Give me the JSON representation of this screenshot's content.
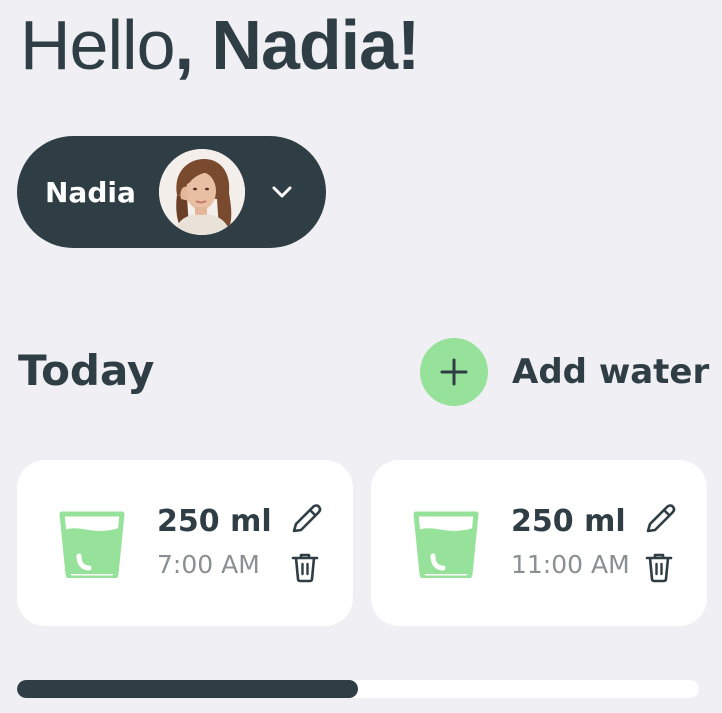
{
  "greeting": {
    "hello": "Hello",
    "name": ", Nadia!"
  },
  "user_selector": {
    "name": "Nadia",
    "avatar_icon": "user-photo",
    "dropdown_icon": "chevron-down-icon"
  },
  "today": {
    "title": "Today",
    "add_label": "Add water",
    "add_icon": "plus-icon"
  },
  "entries": [
    {
      "amount": "250 ml",
      "time": "7:00 AM",
      "icon": "water-glass-icon"
    },
    {
      "amount": "250 ml",
      "time": "11:00 AM",
      "icon": "water-glass-icon"
    }
  ],
  "progress": {
    "fraction": 0.5
  },
  "colors": {
    "background": "#EFEFF4",
    "dark": "#2F3D45",
    "accent_green": "#96E29A",
    "card": "#FFFFFF",
    "muted_text": "#8A8F93"
  }
}
